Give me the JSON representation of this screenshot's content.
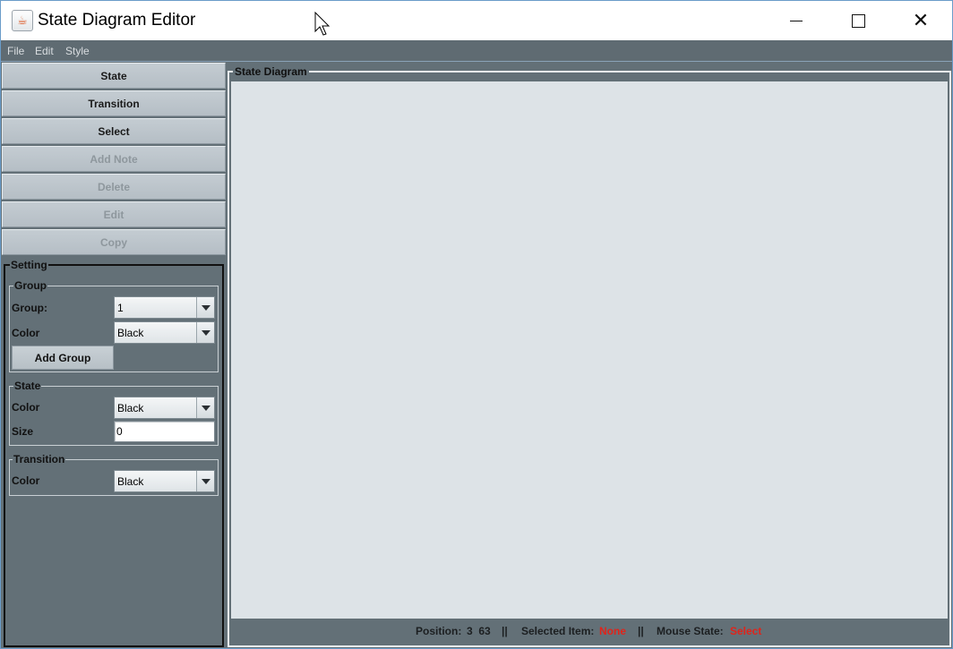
{
  "window": {
    "title": "State Diagram Editor",
    "app_icon": "java-cup-icon"
  },
  "menu": {
    "items": [
      "File",
      "Edit",
      "Style"
    ]
  },
  "toolbar": {
    "state": "State",
    "transition": "Transition",
    "select": "Select",
    "add_note": "Add Note",
    "delete": "Delete",
    "edit": "Edit",
    "copy": "Copy"
  },
  "settings": {
    "title": "Setting",
    "group": {
      "title": "Group",
      "group_label": "Group:",
      "group_value": "1",
      "color_label": "Color",
      "color_value": "Black",
      "add_group_label": "Add Group"
    },
    "state": {
      "title": "State",
      "color_label": "Color",
      "color_value": "Black",
      "size_label": "Size",
      "size_value": "0"
    },
    "transition": {
      "title": "Transition",
      "color_label": "Color",
      "color_value": "Black"
    }
  },
  "diagram": {
    "title": "State Diagram"
  },
  "status": {
    "position_label": "Position:",
    "position_value": "3  63",
    "sep1": "||",
    "selected_label": "Selected Item:",
    "selected_value": "None",
    "sep2": "||",
    "mouse_label": "Mouse State:",
    "mouse_value": "Select"
  },
  "colors": {
    "panel_bg": "#637077",
    "canvas_bg": "#dde3e7",
    "status_highlight": "#e0241b"
  }
}
